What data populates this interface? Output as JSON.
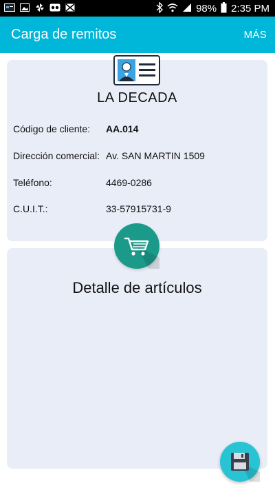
{
  "status_bar": {
    "battery": "98%",
    "time": "2:35 PM"
  },
  "app_bar": {
    "title": "Carga de remitos",
    "more_label": "MÁS"
  },
  "client": {
    "name": "LA DECADA",
    "rows": [
      {
        "label": "Código de cliente:",
        "value": "AA.014"
      },
      {
        "label": "Dirección comercial:",
        "value": "Av. SAN MARTIN 1509"
      },
      {
        "label": "Teléfono:",
        "value": "4469-0286"
      },
      {
        "label": "C.U.I.T.:",
        "value": "33-57915731-9"
      }
    ]
  },
  "detail": {
    "title": "Detalle de artículos"
  },
  "colors": {
    "app_bar": "#00b6d9",
    "card_bg": "#e9edf7",
    "cart_button": "#1b9a8a",
    "save_button": "#29c4d3"
  },
  "icons": [
    "notification-icon",
    "image-icon",
    "pinwheel-icon",
    "voicemail-icon",
    "mail-icon",
    "bluetooth-icon",
    "wifi-icon",
    "signal-icon",
    "battery-icon",
    "id-card-icon",
    "shopping-cart-icon",
    "floppy-disk-icon"
  ]
}
